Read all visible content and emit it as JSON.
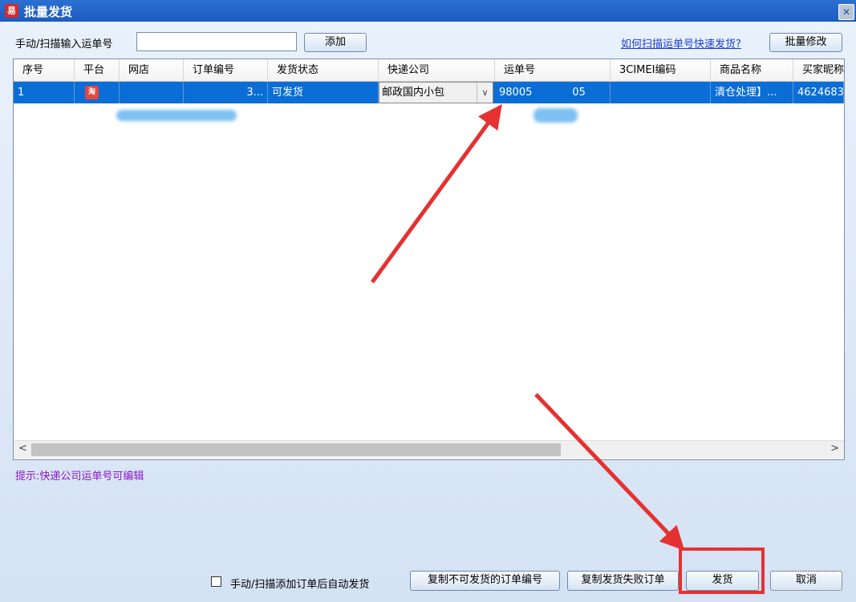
{
  "window": {
    "title": "批量发货",
    "app_icon": "易"
  },
  "toolbar": {
    "input_label": "手动/扫描输入运单号",
    "input_value": "",
    "add_button": "添加",
    "help_link": "如何扫描运单号快速发货?",
    "batch_edit_button": "批量修改"
  },
  "table": {
    "columns": [
      "序号",
      "平台",
      "网店",
      "订单编号",
      "发货状态",
      "快递公司",
      "运单号",
      "3CIMEI编码",
      "商品名称",
      "买家昵称"
    ],
    "rows": [
      {
        "index": "1",
        "platform_icon": "taobao-icon",
        "shop": "",
        "order_no": "3...",
        "status": "可发货",
        "courier": "邮政国内小包",
        "tracking_prefix": "98005",
        "tracking_suffix": "05",
        "imei": "",
        "product": "清仓处理】...",
        "buyer": "4624683"
      }
    ]
  },
  "hint": "提示:快递公司运单号可编辑",
  "footer": {
    "auto_ship_checkbox_label": "手动/扫描添加订单后自动发货",
    "auto_ship_checked": false,
    "copy_unshippable_button": "复制不可发货的订单编号",
    "copy_failed_button": "复制发货失败订单",
    "ship_button": "发货",
    "cancel_button": "取消"
  },
  "colors": {
    "selection": "#0b6dd6",
    "annotation": "#e53131",
    "hint": "#8a16c8",
    "link": "#1b3fcf"
  }
}
